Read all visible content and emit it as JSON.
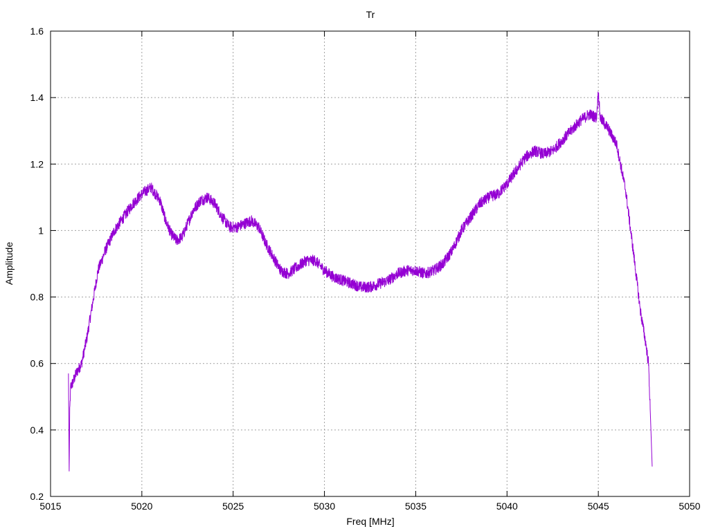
{
  "chart_data": {
    "type": "line",
    "title": "Tr",
    "xlabel": "Freq [MHz]",
    "ylabel": "Amplitude",
    "xlim": [
      5015,
      5050
    ],
    "ylim": [
      0.2,
      1.6
    ],
    "grid": true,
    "xticks": [
      5015,
      5020,
      5025,
      5030,
      5035,
      5040,
      5045,
      5050
    ],
    "yticks": [
      0.2,
      0.4,
      0.6,
      0.8,
      1,
      1.2,
      1.4,
      1.6
    ],
    "xtick_labels": [
      "5015",
      "5020",
      "5025",
      "5030",
      "5035",
      "5040",
      "5045",
      "5050"
    ],
    "ytick_labels": [
      "0.2",
      "0.4",
      "0.6",
      "0.8",
      "1",
      "1.2",
      "1.4",
      "1.6"
    ],
    "series_color": "#9400d3",
    "series": [
      {
        "x": [
          5015.98,
          5016.02,
          5016.05,
          5016.1,
          5016.2,
          5016.4,
          5016.7,
          5017.0,
          5017.3,
          5017.6,
          5018.0,
          5018.5,
          5019.0,
          5019.5,
          5020.0,
          5020.5,
          5021.0,
          5021.3,
          5021.6,
          5021.9,
          5022.2,
          5022.5,
          5022.8,
          5023.2,
          5023.6,
          5024.0,
          5024.4,
          5024.8,
          5025.2,
          5025.6,
          5026.0,
          5026.4,
          5026.8,
          5027.2,
          5027.6,
          5028.0,
          5028.5,
          5029.0,
          5029.5,
          5030.0,
          5030.5,
          5031.0,
          5031.5,
          5032.0,
          5032.5,
          5033.0,
          5033.5,
          5034.0,
          5034.5,
          5035.0,
          5035.5,
          5036.0,
          5036.5,
          5037.0,
          5037.5,
          5038.0,
          5038.5,
          5039.0,
          5039.5,
          5040.0,
          5040.5,
          5041.0,
          5041.5,
          5042.0,
          5042.5,
          5043.0,
          5043.5,
          5044.0,
          5044.5,
          5044.9,
          5045.0,
          5045.1,
          5045.5,
          5046.0,
          5046.5,
          5047.0,
          5047.3,
          5047.6,
          5047.75,
          5047.85,
          5047.95
        ],
        "y": [
          0.57,
          0.27,
          0.45,
          0.53,
          0.54,
          0.57,
          0.6,
          0.68,
          0.78,
          0.88,
          0.94,
          1.0,
          1.04,
          1.08,
          1.11,
          1.13,
          1.09,
          1.03,
          0.99,
          0.97,
          0.98,
          1.02,
          1.06,
          1.09,
          1.1,
          1.08,
          1.04,
          1.01,
          1.01,
          1.02,
          1.03,
          1.01,
          0.96,
          0.92,
          0.88,
          0.87,
          0.89,
          0.91,
          0.91,
          0.88,
          0.86,
          0.85,
          0.84,
          0.83,
          0.83,
          0.84,
          0.85,
          0.87,
          0.88,
          0.88,
          0.87,
          0.88,
          0.9,
          0.94,
          1.0,
          1.04,
          1.08,
          1.1,
          1.11,
          1.14,
          1.18,
          1.22,
          1.24,
          1.23,
          1.24,
          1.27,
          1.3,
          1.33,
          1.35,
          1.34,
          1.42,
          1.34,
          1.31,
          1.26,
          1.12,
          0.9,
          0.76,
          0.66,
          0.6,
          0.45,
          0.29
        ]
      }
    ]
  }
}
